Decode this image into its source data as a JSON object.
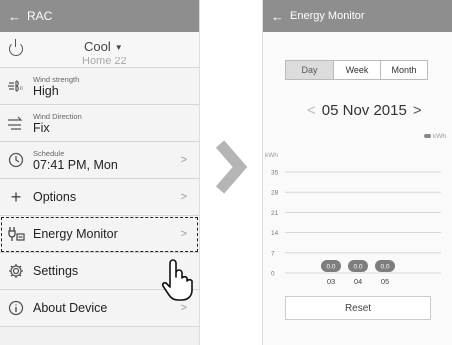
{
  "left": {
    "title": "RAC",
    "mode": "Cool",
    "home": "Home 22",
    "items": [
      {
        "small": "Wind strength",
        "big": "High"
      },
      {
        "small": "Wind Direction",
        "big": "Fix"
      },
      {
        "small": "Schedule",
        "big": "07:41 PM, Mon"
      },
      {
        "label": "Options"
      },
      {
        "label": "Energy Monitor"
      },
      {
        "label": "Settings"
      },
      {
        "label": "About Device"
      }
    ]
  },
  "right": {
    "title": "Energy Monitor",
    "tabs": [
      "Day",
      "Week",
      "Month"
    ],
    "date": "05 Nov 2015",
    "reset": "Reset"
  },
  "chart_data": {
    "type": "bar",
    "ylabel": "kWh",
    "legend": "kWh",
    "yticks": [
      0,
      7,
      14,
      21,
      28,
      35
    ],
    "ylim": [
      0,
      35
    ],
    "categories": [
      "03",
      "04",
      "05"
    ],
    "values": [
      0.0,
      0.0,
      0.0
    ],
    "value_labels": [
      "0.0",
      "0.0",
      "0.0"
    ]
  }
}
